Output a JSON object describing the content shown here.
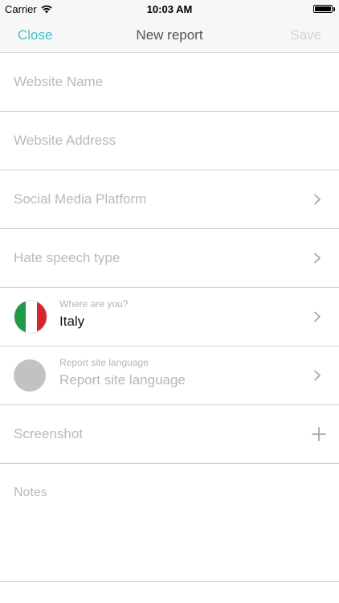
{
  "status_bar": {
    "carrier": "Carrier",
    "time": "10:03 AM"
  },
  "nav": {
    "close_label": "Close",
    "title": "New report",
    "save_label": "Save",
    "accent_color": "#3bc3c8"
  },
  "form": {
    "website_name_placeholder": "Website Name",
    "website_address_placeholder": "Website Address",
    "social_media_platform_label": "Social Media Platform",
    "hate_speech_type_label": "Hate speech type",
    "location": {
      "caption": "Where are you?",
      "value": "Italy",
      "flag_icon": "italy-flag-icon"
    },
    "site_language": {
      "caption": "Report site language",
      "value": "Report site language"
    },
    "screenshot_label": "Screenshot",
    "notes_placeholder": "Notes"
  }
}
